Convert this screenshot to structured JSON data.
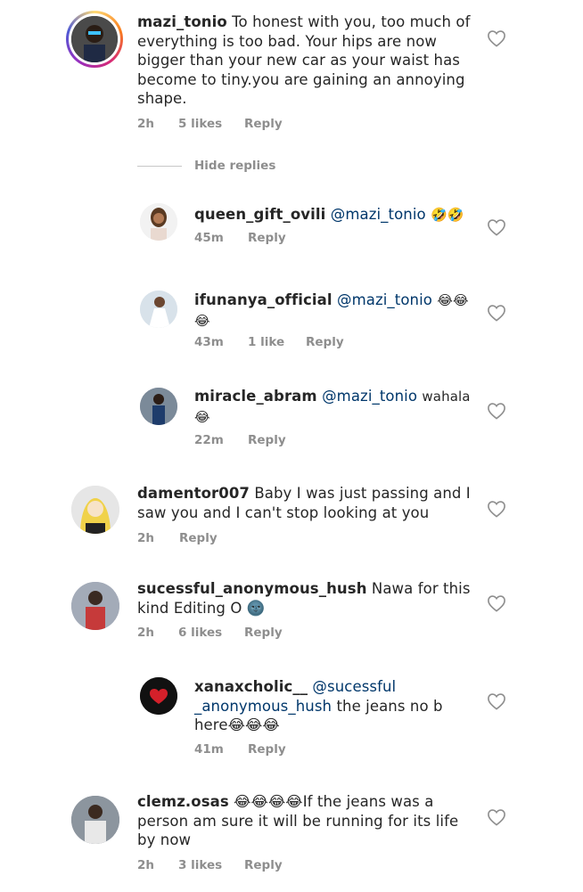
{
  "comments": [
    {
      "username": "mazi_tonio",
      "text": "To honest with you, too much of everything is too bad. Your hips are now bigger than your new car as your waist has become to tiny.you are gaining an annoying shape.",
      "time": "2h",
      "likes": "5 likes",
      "reply": "Reply"
    },
    {
      "username": "queen_gift_ovili",
      "mention": "@mazi_tonio",
      "text": "🤣🤣",
      "time": "45m",
      "reply": "Reply"
    },
    {
      "username": "ifunanya_official",
      "mention": "@mazi_tonio",
      "text": "😂😂😂",
      "time": "43m",
      "likes": "1 like",
      "reply": "Reply"
    },
    {
      "username": "miracle_abram",
      "mention": "@mazi_tonio",
      "text": "wahala 😂",
      "time": "22m",
      "reply": "Reply"
    },
    {
      "username": "damentor007",
      "text": "Baby I was just passing and I saw you and I can't stop looking at you",
      "time": "2h",
      "reply": "Reply"
    },
    {
      "username": "sucessful_anonymous_hush",
      "text": "Nawa for this kind Editing O 🌚",
      "time": "2h",
      "likes": "6 likes",
      "reply": "Reply"
    },
    {
      "username": "xanaxcholic__",
      "mention": "@sucessful _anonymous_hush",
      "text": "the jeans no b here😂😂😂",
      "time": "41m",
      "reply": "Reply"
    },
    {
      "username": "clemz.osas",
      "text": "😂😂😂😂If the jeans was a person am sure it will be running for its life by now",
      "time": "2h",
      "likes": "3 likes",
      "reply": "Reply"
    }
  ],
  "hide_replies_label": "Hide replies",
  "icons": {
    "like": "heart-outline-icon"
  },
  "colors": {
    "mention": "#00376b",
    "meta": "#8e8e8e",
    "text": "#262626"
  }
}
